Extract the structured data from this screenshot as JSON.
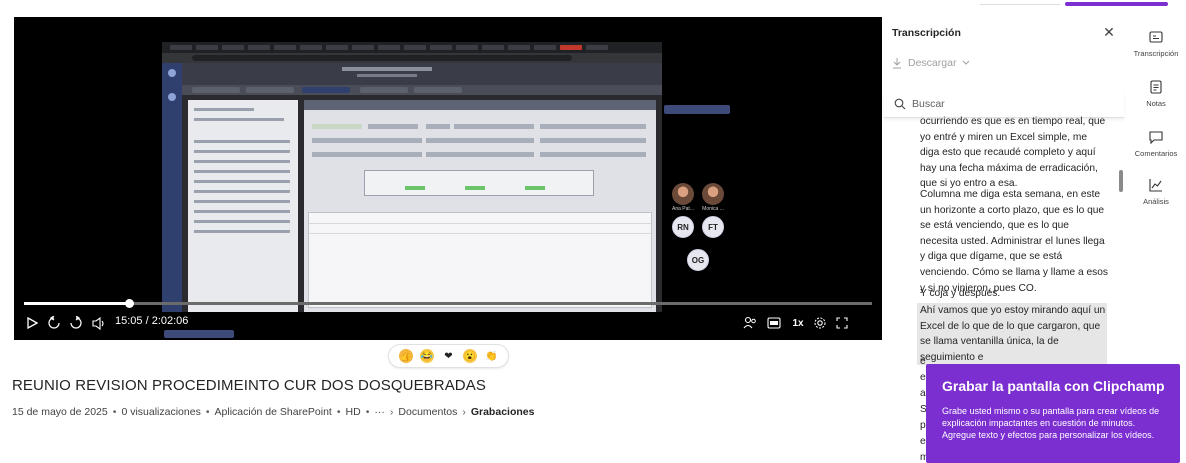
{
  "video": {
    "time_display": "15:05 / 2:02:06",
    "progress_fraction": 0.124,
    "speed_label": "1x",
    "participants": [
      {
        "label": "Ana Pat...",
        "initials": "",
        "photo": true
      },
      {
        "label": "Monica ...",
        "initials": "",
        "photo": true
      },
      {
        "label": "",
        "initials": "RN",
        "photo": false
      },
      {
        "label": "",
        "initials": "FT",
        "photo": false
      },
      {
        "label": "",
        "initials": "OG",
        "photo": false
      }
    ]
  },
  "reactions": [
    "like-emoji",
    "laugh-emoji",
    "heart-emoji",
    "surprised-emoji",
    "applause-emoji"
  ],
  "title": "REUNIO REVISION PROCEDIMEINTO CUR DOS DOSQUEBRADAS",
  "meta": {
    "date": "15 de mayo de 2025",
    "views": "0 visualizaciones",
    "source": "Aplicación de SharePoint",
    "quality": "HD",
    "more": "···",
    "crumb1": "Documentos",
    "crumb2": "Grabaciones"
  },
  "transcript": {
    "title": "Transcripción",
    "download_label": "Descargar",
    "search_placeholder": "Buscar",
    "blocks": [
      {
        "text": "ocurriendo es que es en tiempo real, que yo entré y miren un Excel simple, me diga esto que recaudé completo y aquí hay una fecha máxima de erradicación, que si yo entro a esa.",
        "highlight": false
      },
      {
        "text": "Columna me diga esta semana, en este un horizonte a corto plazo, que es lo que se está venciendo, que es lo que necesita usted. Administrar el lunes llega y diga que dígame, que se está venciendo. Cómo se llama y llame a esos y si no vinieron, pues CO.",
        "highlight": false
      },
      {
        "text": "Y coja y después.",
        "highlight": false
      },
      {
        "text": "Ahí vamos que yo estoy mirando aquí un Excel de lo que de lo que cargaron, que se llama ventanilla única, la de seguimiento e",
        "highlight": true
      },
      {
        "text": "e",
        "highlight": false
      },
      {
        "text": "e",
        "highlight": false
      },
      {
        "text": "a",
        "highlight": false
      },
      {
        "text": "S",
        "highlight": false
      },
      {
        "text": "p",
        "highlight": false
      },
      {
        "text": "e",
        "highlight": false
      },
      {
        "text": "m",
        "highlight": false
      }
    ]
  },
  "rail": {
    "transcription": "Transcripción",
    "notes": "Notas",
    "comments": "Comentarios",
    "analytics": "Análisis"
  },
  "promo": {
    "title": "Grabar la pantalla con Clipchamp",
    "text": "Grabe usted mismo o su pantalla para crear vídeos de explicación impactantes en cuestión de minutos. Agregue texto y efectos para personalizar los vídeos."
  },
  "colors": {
    "accent": "#7b2fd1",
    "player_bg": "#000000",
    "highlight": "#e6e6e6"
  }
}
